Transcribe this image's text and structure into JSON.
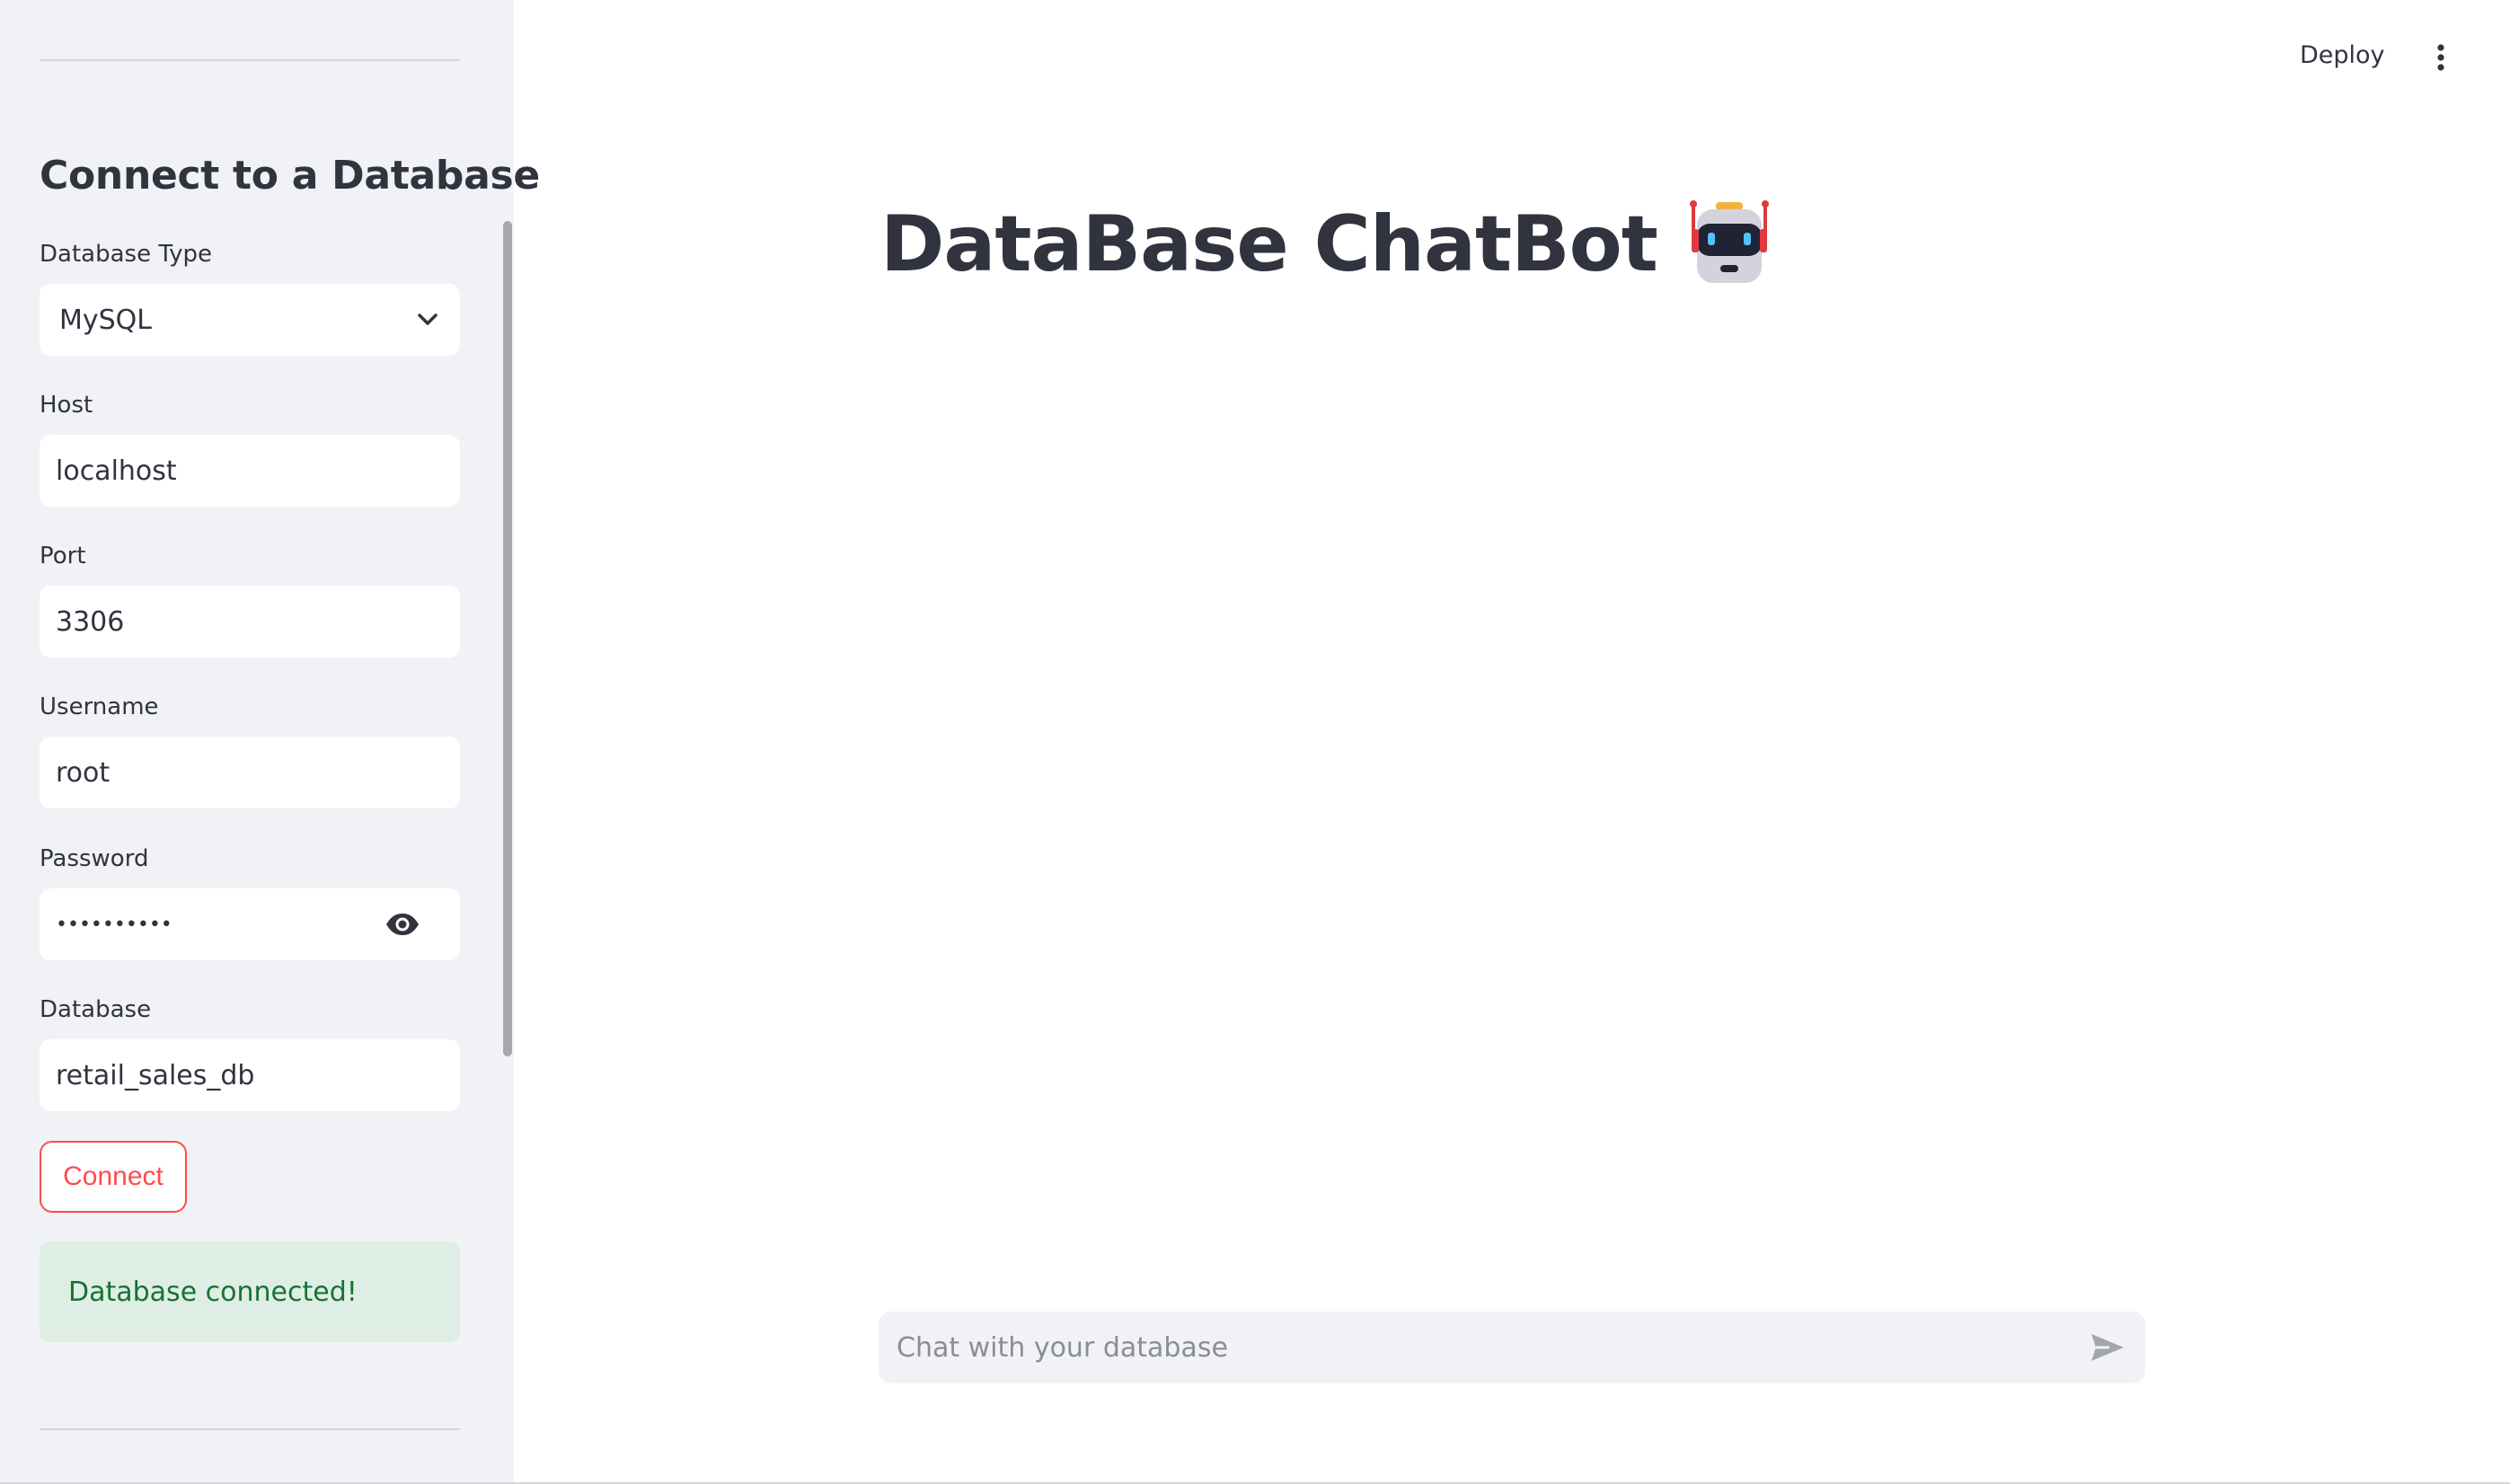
{
  "header": {
    "deploy_label": "Deploy",
    "menu_icon": "vertical-dots-icon"
  },
  "sidebar": {
    "heading": "Connect to a Database",
    "fields": {
      "db_type": {
        "label": "Database Type",
        "value": "MySQL",
        "icon": "chevron-down-icon"
      },
      "host": {
        "label": "Host",
        "value": "localhost"
      },
      "port": {
        "label": "Port",
        "value": "3306"
      },
      "username": {
        "label": "Username",
        "value": "root"
      },
      "password": {
        "label": "Password",
        "value": "••••••••••",
        "icon": "eye-icon"
      },
      "database": {
        "label": "Database",
        "value": "retail_sales_db"
      }
    },
    "connect_label": "Connect",
    "status_message": "Database connected!"
  },
  "main": {
    "title": "DataBase ChatBot",
    "title_icon": "robot-icon",
    "chat": {
      "placeholder": "Chat with your database",
      "send_icon": "send-icon"
    }
  },
  "colors": {
    "accent": "#ff4b4b",
    "sidebar_bg": "#f0f2f6",
    "text": "#31333f",
    "success_bg": "#dfeee5",
    "success_text": "#177233"
  }
}
